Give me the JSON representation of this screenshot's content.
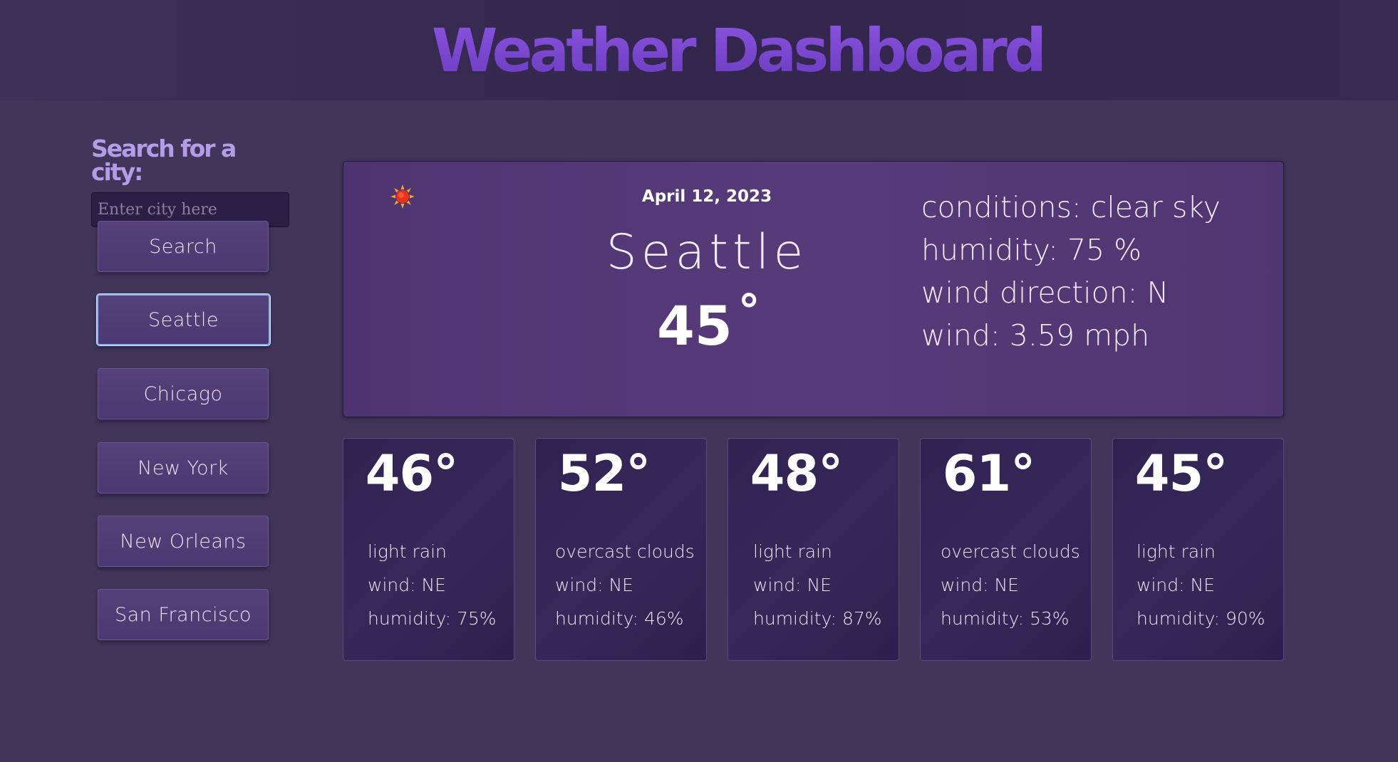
{
  "header": {
    "title": "Weather Dashboard"
  },
  "sidebar": {
    "label": "Search for a city:",
    "search_placeholder": "Enter city here",
    "search_button": "Search",
    "cities": [
      "Seattle",
      "Chicago",
      "New York",
      "New Orleans",
      "San Francisco"
    ],
    "selected_city": "Seattle"
  },
  "current": {
    "icon": "sun-icon",
    "date": "April 12, 2023",
    "city": "Seattle",
    "temp": "45",
    "degree": "°",
    "conditions": "conditions: clear sky",
    "humidity": "humidity: 75 %",
    "wind_direction": "wind direction: N",
    "wind": "wind: 3.59 mph"
  },
  "forecast": [
    {
      "temp": "46°",
      "condition": "light rain",
      "wind": "wind: NE",
      "humidity": "humidity: 75%"
    },
    {
      "temp": "52°",
      "condition": "overcast clouds",
      "wind": "wind: NE",
      "humidity": "humidity: 46%"
    },
    {
      "temp": "48°",
      "condition": "light rain",
      "wind": "wind: NE",
      "humidity": "humidity: 87%"
    },
    {
      "temp": "61°",
      "condition": "overcast clouds",
      "wind": "wind: NE",
      "humidity": "humidity: 53%"
    },
    {
      "temp": "45°",
      "condition": "light rain",
      "wind": "wind: NE",
      "humidity": "humidity: 90%"
    }
  ],
  "colors": {
    "background": "#41365a",
    "header_bg": "#33264c",
    "title_purple": "#7a46d4",
    "label_lavender": "#b49ce8",
    "card_bg": "#2f2150",
    "current_bg": "#573a7a",
    "active_outline": "#8ab4ff"
  }
}
